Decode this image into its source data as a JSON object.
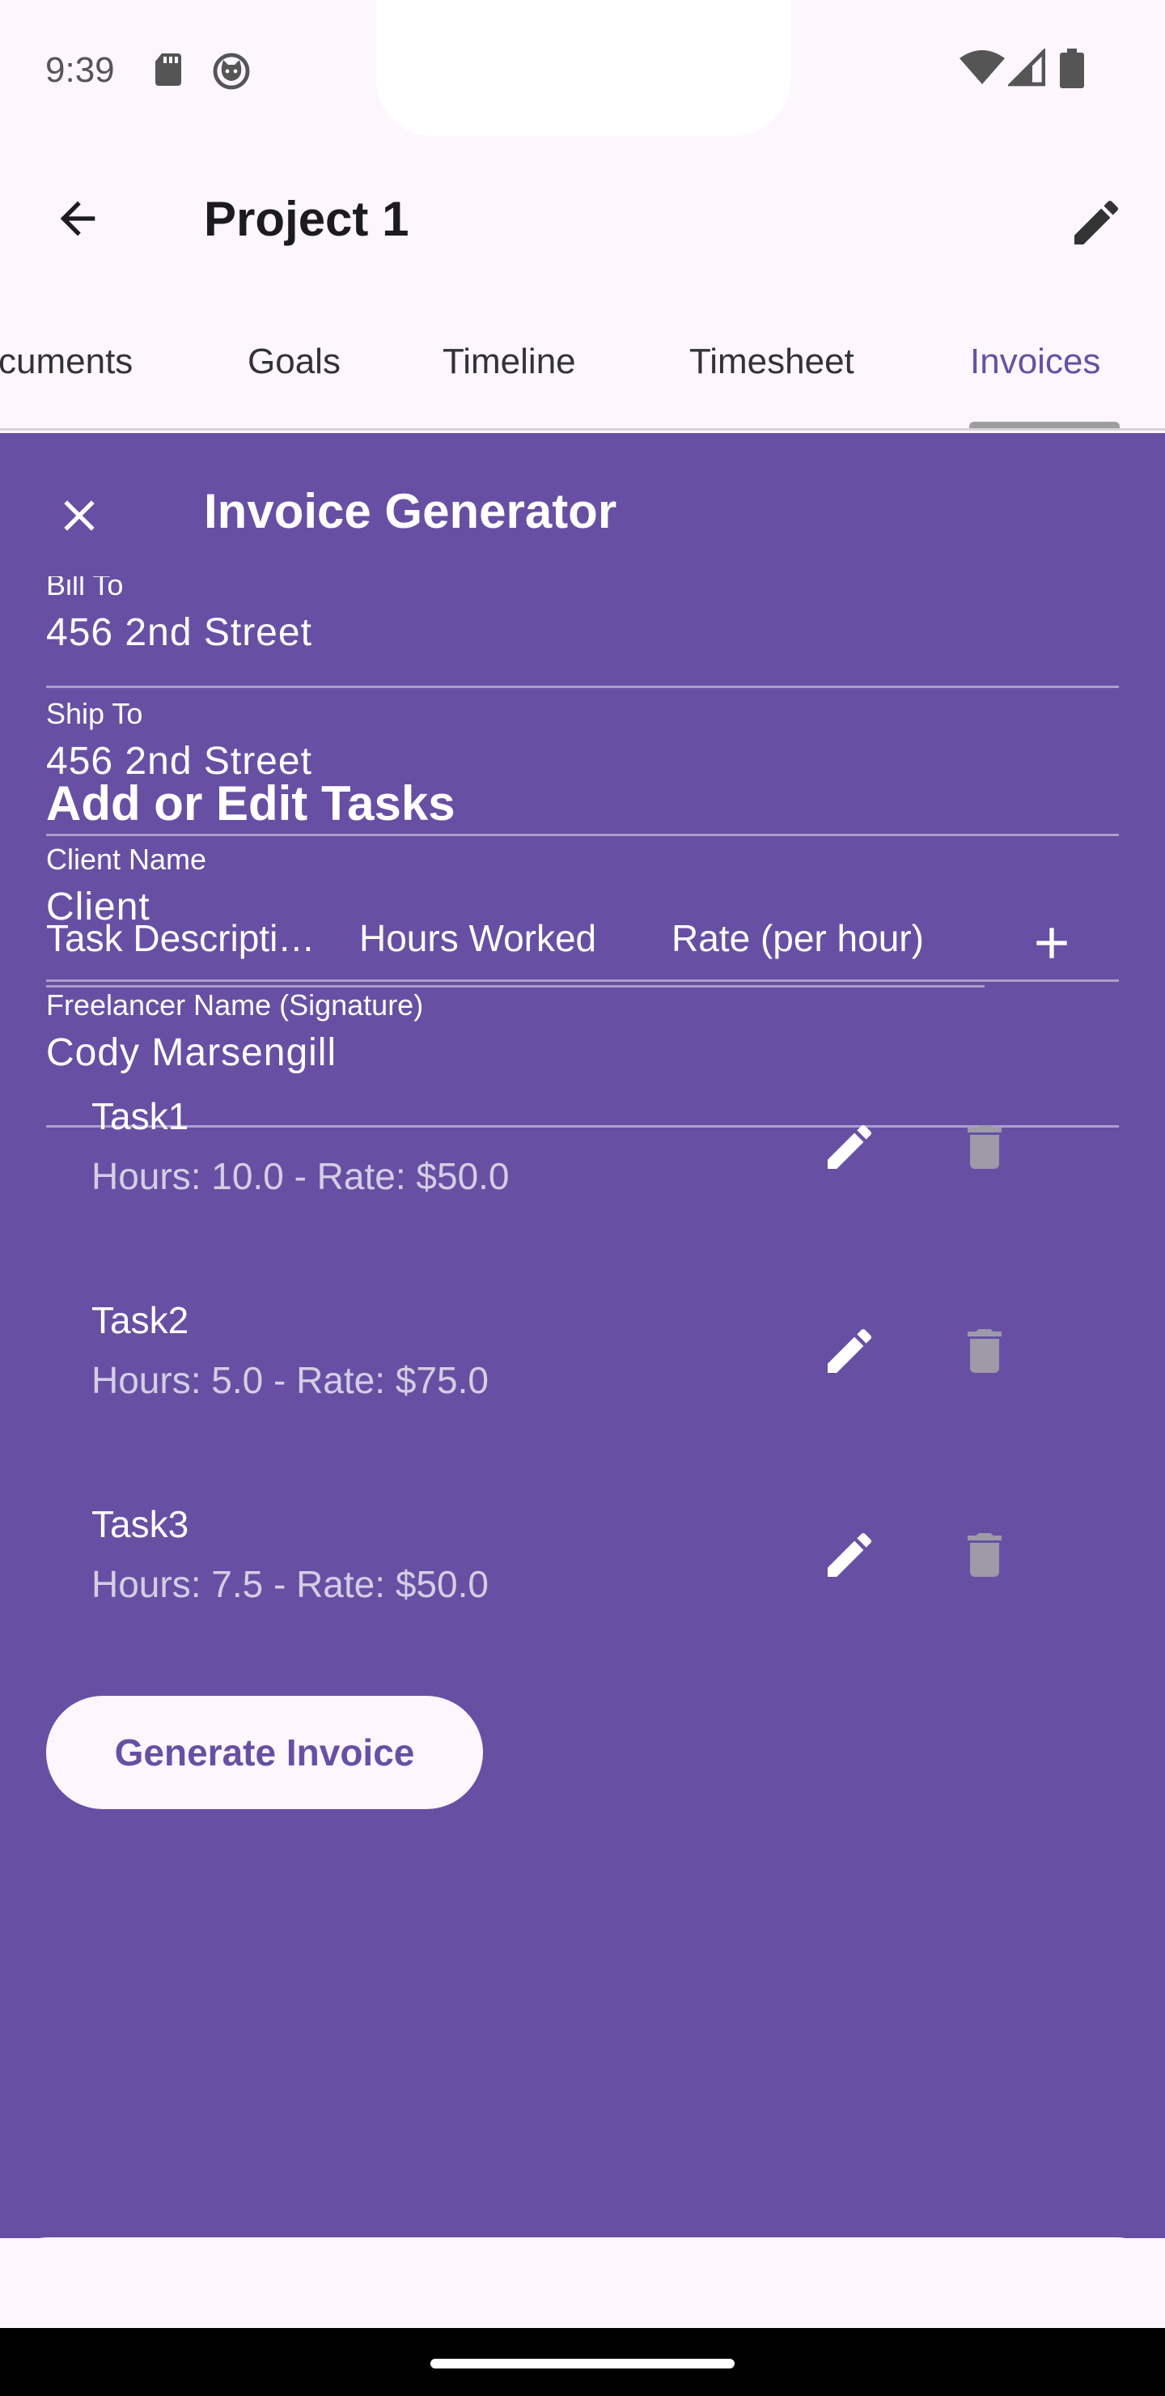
{
  "status_bar": {
    "time": "9:39",
    "left_icons": [
      "sd-card-icon",
      "cat-face-icon"
    ],
    "right_icons": [
      "wifi-icon",
      "cellular-signal-icon",
      "battery-icon"
    ]
  },
  "app_bar": {
    "title": "Project 1",
    "back_icon": "arrow-back-icon",
    "edit_icon": "pencil-icon"
  },
  "tabs": {
    "items": [
      {
        "label": "cuments",
        "active": false
      },
      {
        "label": "Goals",
        "active": false
      },
      {
        "label": "Timeline",
        "active": false
      },
      {
        "label": "Timesheet",
        "active": false
      },
      {
        "label": "Invoices",
        "active": true
      }
    ]
  },
  "invoice_generator": {
    "title": "Invoice Generator",
    "close_icon": "close-icon",
    "fields": [
      {
        "label": "Bill To",
        "value": "456 2nd Street"
      },
      {
        "label": "Ship To",
        "value": "456 2nd Street"
      },
      {
        "label": "Client Name",
        "value": "Client"
      },
      {
        "label": "Freelancer Name (Signature)",
        "value": "Cody Marsengill"
      }
    ],
    "tasks_section": {
      "title": "Add or Edit Tasks",
      "inputs": {
        "description_placeholder": "Task Descripti…",
        "hours_placeholder": "Hours Worked",
        "rate_placeholder": "Rate (per hour)"
      },
      "add_icon": "plus-icon",
      "tasks": [
        {
          "name": "Task1",
          "details": "Hours: 10.0 - Rate: $50.0"
        },
        {
          "name": "Task2",
          "details": "Hours: 5.0 - Rate: $75.0"
        },
        {
          "name": "Task3",
          "details": "Hours: 7.5 - Rate: $50.0"
        }
      ]
    },
    "generate_button": "Generate Invoice"
  },
  "colors": {
    "accent": "#6750a4",
    "panel_background": "#6750a3",
    "surface": "#fdf6fc"
  }
}
